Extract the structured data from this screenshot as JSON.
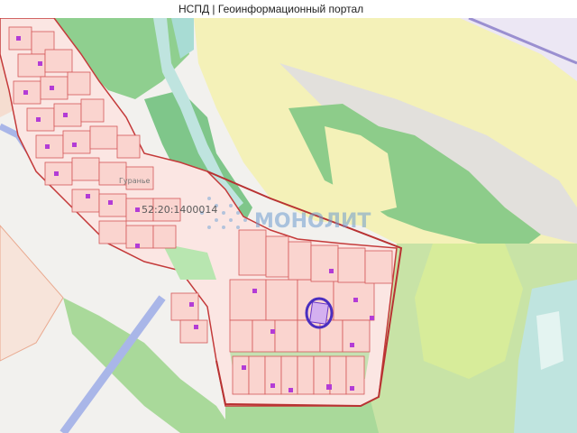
{
  "header": {
    "title": "НСПД | Геоинформационный портал"
  },
  "map": {
    "cadastral_block": "52:20:1400014",
    "settlement_label": "Гуранье",
    "watermark": "МОНОЛИТ",
    "highlight_color": "#4a2ec0",
    "parcel_color": "#c43a3a",
    "building_color": "#b33cd6"
  }
}
